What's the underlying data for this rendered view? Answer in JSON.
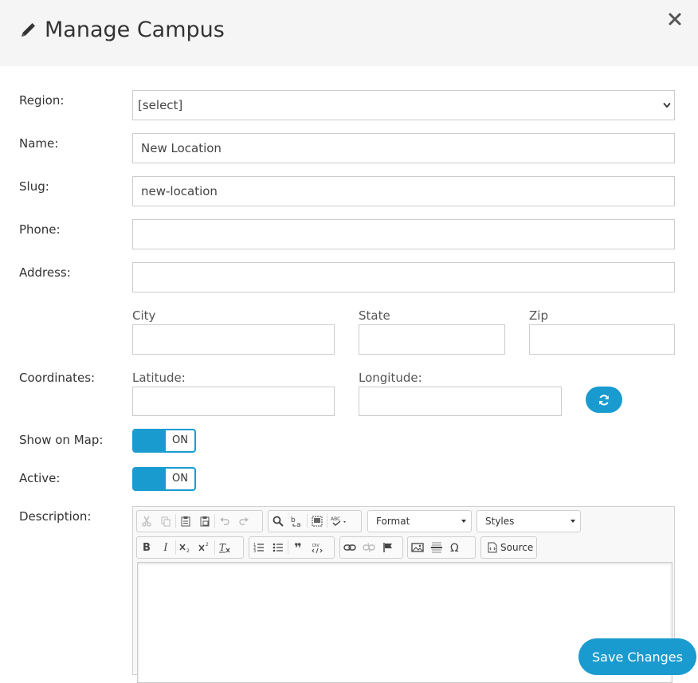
{
  "header": {
    "title": "Manage Campus"
  },
  "form": {
    "region": {
      "label": "Region:",
      "value": "[select]"
    },
    "name": {
      "label": "Name:",
      "value": "New Location"
    },
    "slug": {
      "label": "Slug:",
      "value": "new-location"
    },
    "phone": {
      "label": "Phone:",
      "value": ""
    },
    "address": {
      "label": "Address:",
      "value": ""
    },
    "city": {
      "label": "City",
      "value": ""
    },
    "state": {
      "label": "State",
      "value": ""
    },
    "zip": {
      "label": "Zip",
      "value": ""
    },
    "coordinates": {
      "label": "Coordinates:",
      "latitude_label": "Latitude:",
      "longitude_label": "Longitude:",
      "latitude": "",
      "longitude": ""
    },
    "show_on_map": {
      "label": "Show on Map:",
      "state": "ON"
    },
    "active": {
      "label": "Active:",
      "state": "ON"
    },
    "description": {
      "label": "Description:"
    }
  },
  "editor": {
    "format_label": "Format",
    "styles_label": "Styles",
    "source_label": "Source",
    "bold_label": "B",
    "italic_label": "I",
    "quote_label": "❞"
  },
  "footer": {
    "save_label": "Save Changes"
  },
  "colors": {
    "accent": "#1a9bd0",
    "header_bg": "#f5f5f5"
  }
}
